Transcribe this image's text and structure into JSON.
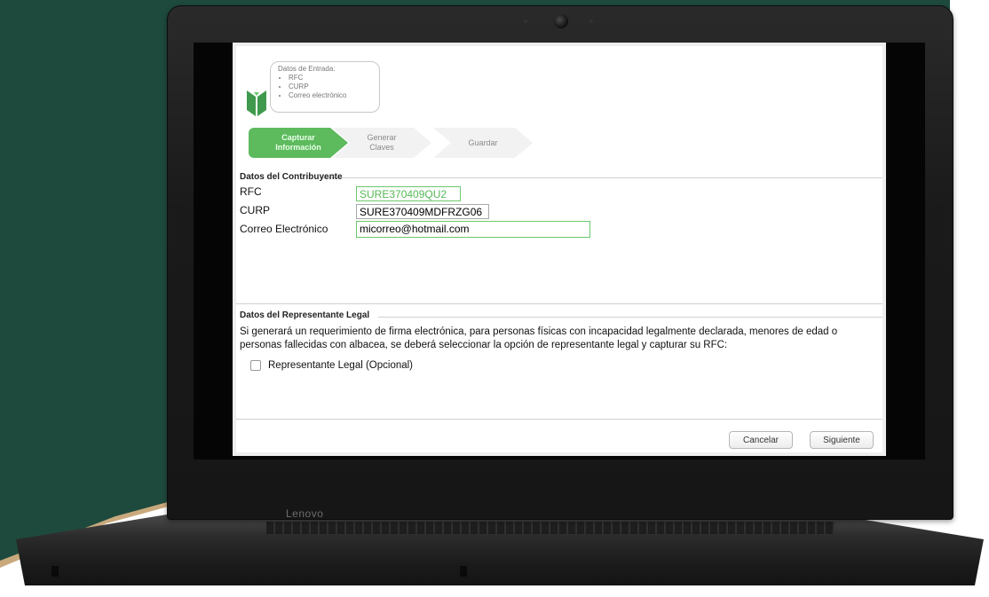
{
  "device": {
    "brand": "Lenovo"
  },
  "app": {
    "datos_entrada": {
      "title": "Datos de Entrada:",
      "items": [
        "RFC",
        "CURP",
        "Correo electrónico"
      ]
    },
    "steps": [
      {
        "line1": "Capturar",
        "line2": "Información",
        "state": "active"
      },
      {
        "line1": "Generar",
        "line2": "Claves",
        "state": "inactive"
      },
      {
        "line1": "Guardar",
        "line2": "",
        "state": "inactive"
      }
    ],
    "contribuyente": {
      "section_title": "Datos del Contribuyente",
      "rfc_label": "RFC",
      "rfc_value": "SURE370409QU2",
      "curp_label": "CURP",
      "curp_value": "SURE370409MDFRZG06",
      "email_label": "Correo Electrónico",
      "email_value": "micorreo@hotmail.com"
    },
    "representante": {
      "section_title": "Datos del Representante Legal",
      "description": "Si generará un requerimiento de firma electrónica, para personas físicas con incapacidad legalmente declarada, menores de edad o personas fallecidas con albacea, se deberá seleccionar la opción de representante legal y capturar su RFC:",
      "checkbox_label": "Representante Legal (Opcional)",
      "checkbox_checked": false
    },
    "buttons": {
      "cancel": "Cancelar",
      "next": "Siguiente"
    },
    "colors": {
      "accent": "#5dba5d",
      "field_border": "#6cc86c"
    }
  }
}
